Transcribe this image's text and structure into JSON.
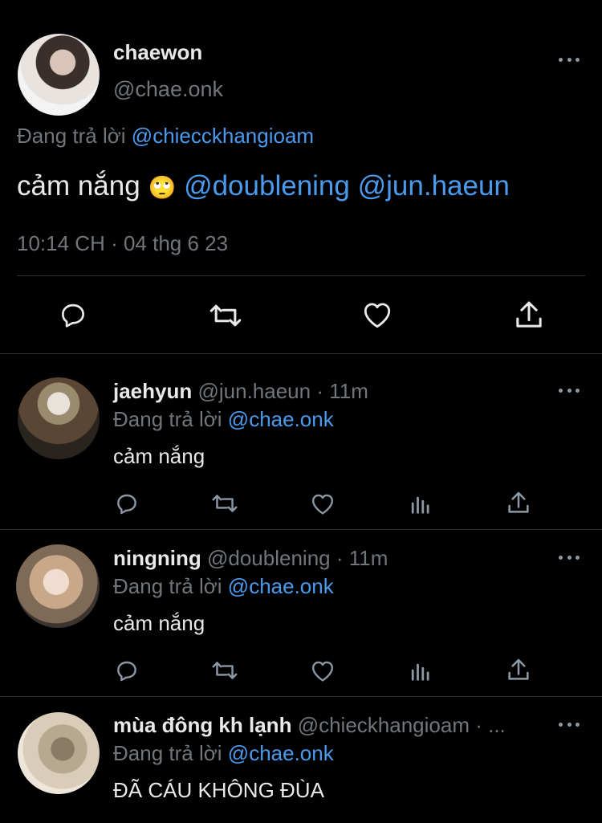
{
  "main_tweet": {
    "name": "chaewon",
    "handle": "@chae.onk",
    "reply_prefix": "Đang trả lời",
    "reply_to": "@chiecckhangioam",
    "text": "cảm nắng",
    "emoji": "🙄",
    "mention1": "@doublening",
    "mention2": "@jun.haeun",
    "timestamp": "10:14 CH · 04 thg 6 23"
  },
  "replies": [
    {
      "name": "jaehyun",
      "handle": "@jun.haeun",
      "time": "· 11m",
      "reply_prefix": "Đang trả lời",
      "reply_to": "@chae.onk",
      "text": "cảm nắng"
    },
    {
      "name": "ningning",
      "handle": "@doublening",
      "time": "· 11m",
      "reply_prefix": "Đang trả lời",
      "reply_to": "@chae.onk",
      "text": "cảm nắng"
    },
    {
      "name": "mùa đông kh lạnh",
      "handle": "@chieckhangioam",
      "time": "· ...",
      "reply_prefix": "Đang trả lời",
      "reply_to": "@chae.onk",
      "text": "ĐÃ CÁU KHÔNG ĐÙA"
    }
  ],
  "colors": {
    "background": "#000000",
    "text": "#e7e9ea",
    "secondary": "#71767b",
    "link": "#4a9bee",
    "divider": "#2f3336"
  },
  "icons": [
    "reply-icon",
    "retweet-icon",
    "like-icon",
    "views-icon",
    "share-icon",
    "more-icon"
  ]
}
